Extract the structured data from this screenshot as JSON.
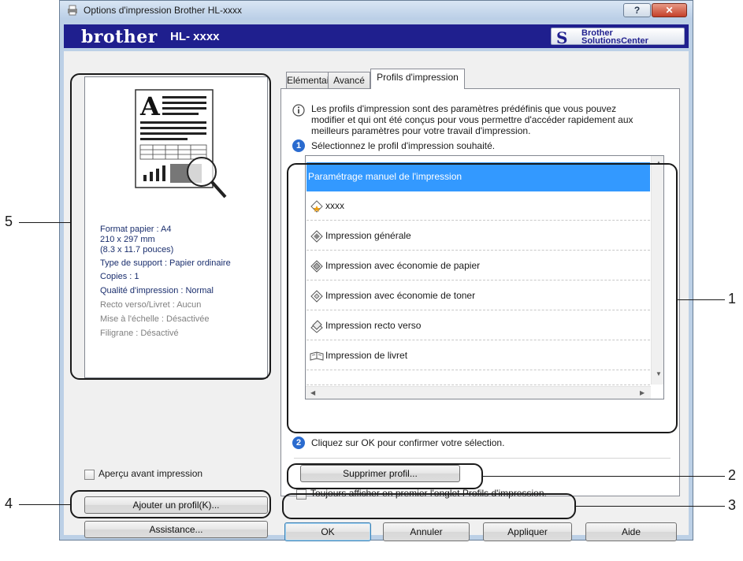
{
  "window": {
    "title": "Options d'impression Brother HL-xxxx",
    "help_label": "?",
    "close_label": "✕"
  },
  "brand": {
    "logo": "brother",
    "model": "HL- xxxx",
    "solutions_line1": "Brother",
    "solutions_line2": "SolutionsCenter"
  },
  "summary": {
    "paper_format": "Format papier : A4",
    "dimensions_mm": "210 x 297 mm",
    "dimensions_in": "(8.3 x 11.7 pouces)",
    "media_type": "Type de support : Papier ordinaire",
    "copies": "Copies : 1",
    "quality": "Qualité d'impression : Normal",
    "duplex": "Recto verso/Livret : Aucun",
    "scaling": "Mise à l'échelle : Désactivée",
    "watermark": "Filigrane : Désactivé"
  },
  "left_controls": {
    "preview_checkbox_label": "Aperçu avant impression",
    "add_profile_label": "Ajouter un profil(K)...",
    "assistance_label": "Assistance..."
  },
  "tabs": [
    {
      "label": "Elémentaire"
    },
    {
      "label": "Avancé"
    },
    {
      "label": "Profils d'impression"
    }
  ],
  "profiles_tab": {
    "info_line1": "Les profils d'impression sont des paramètres prédéfinis que vous pouvez",
    "info_line2": "modifier et qui ont été conçus pour vous permettre d'accéder rapidement aux",
    "info_line3": "meilleurs paramètres pour votre travail d'impression.",
    "step1_num": "1",
    "step1_text": "Sélectionnez le profil d'impression souhaité.",
    "profiles": [
      {
        "label": "Paramétrage manuel de l'impression",
        "icon": "none",
        "selected": true
      },
      {
        "label": "xxxx",
        "icon": "star-page-icon"
      },
      {
        "label": "Impression générale",
        "icon": "general-print-icon"
      },
      {
        "label": "Impression avec économie de papier",
        "icon": "paper-saving-icon"
      },
      {
        "label": "Impression avec économie de toner",
        "icon": "toner-saving-icon"
      },
      {
        "label": "Impression recto verso",
        "icon": "duplex-icon"
      },
      {
        "label": "Impression de livret",
        "icon": "booklet-icon"
      }
    ],
    "step2_num": "2",
    "step2_text": "Cliquez sur OK pour confirmer votre sélection.",
    "delete_profile_label": "Supprimer profil...",
    "always_show_label": "Toujours afficher en premier l'onglet Profils d'impression."
  },
  "bottom_buttons": {
    "ok": "OK",
    "cancel": "Annuler",
    "apply": "Appliquer",
    "help": "Aide"
  },
  "callouts": [
    "1",
    "2",
    "3",
    "4",
    "5"
  ],
  "colors": {
    "brand_bar": "#1f1f8e",
    "selection": "#3399ff",
    "step_circle": "#2a6bcf"
  }
}
